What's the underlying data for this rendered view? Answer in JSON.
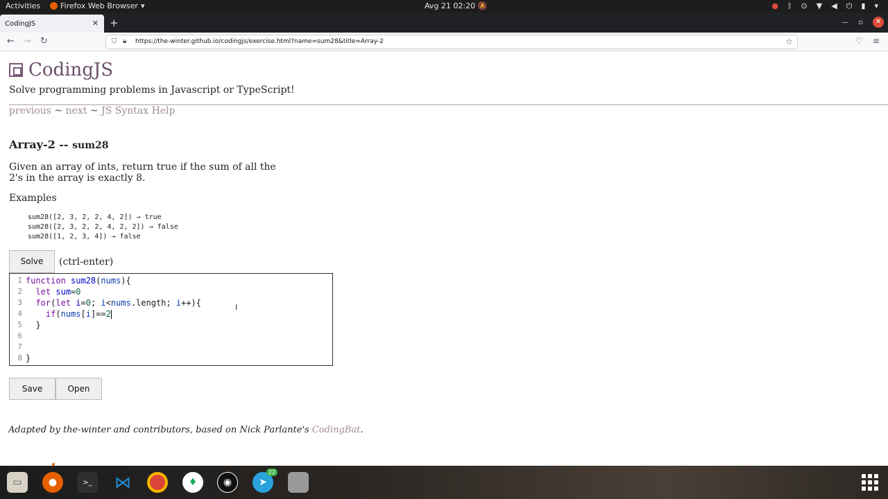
{
  "topbar": {
    "activities": "Activities",
    "app_name": "Firefox Web Browser",
    "clock": "Avg 21  02:20"
  },
  "browser": {
    "tab_title": "CodingJS",
    "url": "https://the-winter.github.io/codingjs/exercise.html?name=sum28&title=Array-2"
  },
  "page": {
    "site_name": "CodingJS",
    "tagline": "Solve programming problems in Javascript or TypeScript!",
    "nav": {
      "previous": "previous",
      "next": "next",
      "help": "JS Syntax Help",
      "sep": "~"
    },
    "title_prefix": "Array-2 -- ",
    "function_name": "sum28",
    "description": "Given an array of ints, return true if the sum of all the 2's in the array is exactly 8.",
    "examples_label": "Examples",
    "examples": [
      "sum28([2, 3, 2, 2, 4, 2]) → true",
      "sum28([2, 3, 2, 2, 4, 2, 2]) → false",
      "sum28([1, 2, 3, 4]) → false"
    ],
    "solve_label": "Solve",
    "shortcut": "(ctrl-enter)",
    "line_numbers": [
      "1",
      "2",
      "3",
      "4",
      "5",
      "6",
      "7",
      "8"
    ],
    "save_label": "Save",
    "open_label": "Open",
    "footer_text": "Adapted by the-winter and contributors, based on Nick Parlante's ",
    "footer_link": "CodingBat",
    "footer_end": "."
  },
  "code": {
    "l1_kw": "function",
    "l1_name": "sum28",
    "l1_open": "(",
    "l1_param": "nums",
    "l1_close": "){",
    "l2_kw": "let",
    "l2_var": "sum",
    "l2_eq": "=",
    "l2_num": "0",
    "l3_kw": "for",
    "l3_a": "(",
    "l3_let": "let",
    "l3_i": "i",
    "l3_b": "=",
    "l3_zero": "0",
    "l3_c": "; ",
    "l3_i2": "i",
    "l3_d": "<",
    "l3_nums": "nums",
    "l3_e": ".length; ",
    "l3_i3": "i",
    "l3_f": "++){",
    "l4_kw": "if",
    "l4_a": "(",
    "l4_nums": "nums",
    "l4_b": "[",
    "l4_i": "i",
    "l4_c": "]==",
    "l4_two": "2",
    "l5": "}",
    "l8": "}"
  },
  "dock": {
    "telegram_badge": "22"
  },
  "colors": {
    "accent": "#6b4f69",
    "link": "#a08a9c",
    "firefox": "#e66000"
  }
}
